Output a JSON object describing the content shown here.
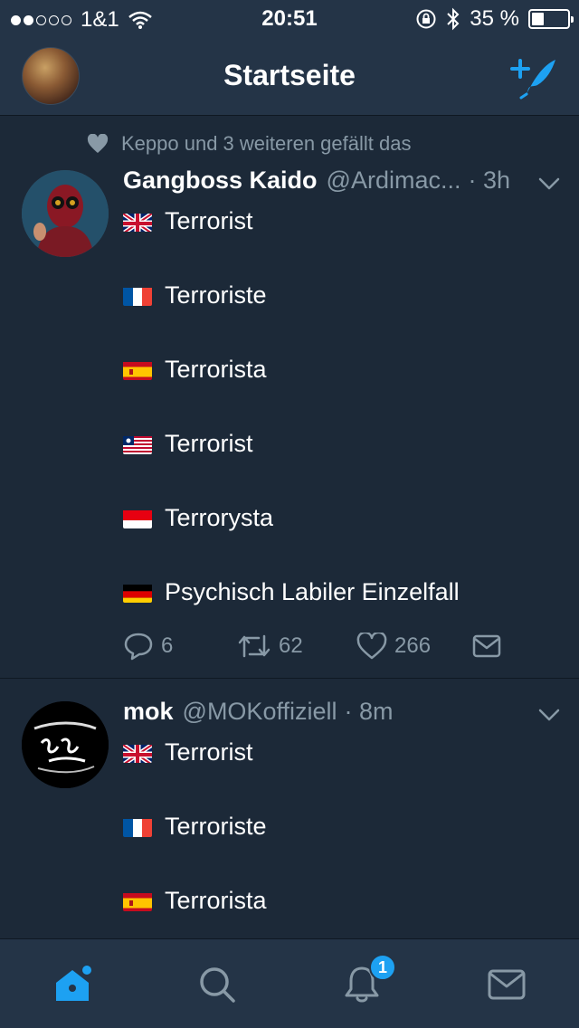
{
  "status_bar": {
    "carrier": "1&1",
    "time": "20:51",
    "battery": "35 %",
    "battery_level": 0.35
  },
  "nav": {
    "title": "Startseite"
  },
  "tweets": [
    {
      "social_context": "Keppo und 3 weiteren gefällt das",
      "name": "Gangboss Kaido",
      "handle": "@Ardimac...",
      "time": "· 3h",
      "lines": [
        {
          "flag": "uk-flag",
          "text": "Terrorist"
        },
        {
          "flag": "france-flag",
          "text": "Terroriste"
        },
        {
          "flag": "spain-flag",
          "text": "Terrorista"
        },
        {
          "flag": "liberia-flag",
          "text": "Terrorist"
        },
        {
          "flag": "indonesia-flag",
          "text": "Terrorysta"
        },
        {
          "flag": "germany-flag",
          "text": "Psychisch Labiler Einzelfall"
        }
      ],
      "replies": "6",
      "retweets": "62",
      "likes": "266"
    },
    {
      "name": "mok",
      "handle": "@MOKoffiziell",
      "time": "· 8m",
      "lines": [
        {
          "flag": "uk-flag",
          "text": "Terrorist"
        },
        {
          "flag": "france-flag",
          "text": "Terroriste"
        },
        {
          "flag": "spain-flag",
          "text": "Terrorista"
        }
      ]
    }
  ],
  "tabs": {
    "notifications_badge": "1"
  },
  "colors": {
    "background": "#1c2938",
    "bar": "#243447",
    "accent": "#1da1f2",
    "muted": "#8899a6"
  }
}
